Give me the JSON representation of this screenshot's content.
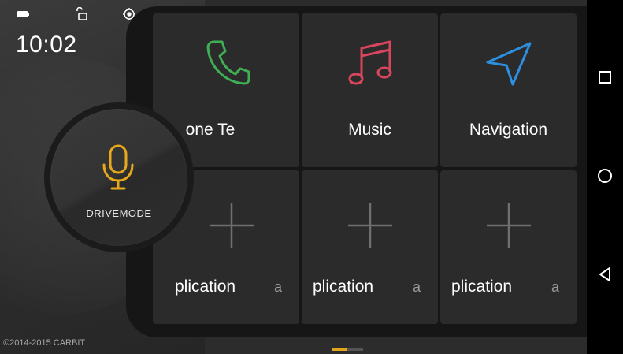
{
  "status_bar": {
    "icons": [
      "battery-icon",
      "unlock-icon",
      "location-icon"
    ],
    "time": "10:02"
  },
  "drive_mode": {
    "icon": "microphone-icon",
    "label": "DRIVEMODE"
  },
  "tiles": [
    {
      "label": "one    Te",
      "icon": "phone-icon",
      "color": "#3fae55"
    },
    {
      "label": "Music",
      "icon": "music-icon",
      "color": "#d8465d"
    },
    {
      "label": "Navigation",
      "icon": "navigation-arrow-icon",
      "color": "#2c8fe0"
    },
    {
      "label_main": "plication",
      "label_tail": "a",
      "icon": "plus-icon"
    },
    {
      "label_main": "plication",
      "label_tail": "a",
      "icon": "plus-icon"
    },
    {
      "label_main": "plication",
      "label_tail": "a",
      "icon": "plus-icon"
    }
  ],
  "footer": {
    "copyright": "©2014-2015 CARBIT",
    "page_indicator": {
      "pages": 2,
      "current": 1,
      "active_color": "#e2a31d",
      "inactive_color": "#555555"
    }
  },
  "nav_bar": {
    "buttons": [
      "recents-square-icon",
      "home-circle-icon",
      "back-triangle-icon"
    ]
  },
  "colors": {
    "mic_accent": "#e8a81c",
    "background": "#2c2c2c",
    "tile": "#2b2b2b"
  }
}
